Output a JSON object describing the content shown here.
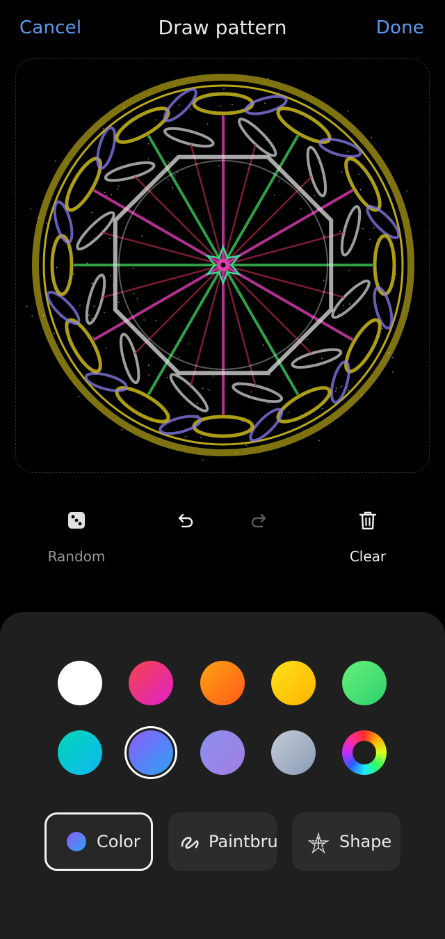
{
  "header": {
    "cancel_label": "Cancel",
    "title": "Draw pattern",
    "done_label": "Done",
    "accent_color": "#5b9cf0"
  },
  "canvas": {
    "description_icon": "kaleidoscope-pattern",
    "stroke_colors": [
      "#e6d21e",
      "#8a7cf0",
      "#e0e0e0",
      "#e03cb4",
      "#3cc85a",
      "#b02a4a"
    ]
  },
  "tools": {
    "random_label": "Random",
    "undo_icon": "undo-icon",
    "redo_icon": "redo-icon",
    "clear_label": "Clear"
  },
  "palette": {
    "selected_index": 6,
    "swatches": [
      {
        "name": "white",
        "colors": [
          "#ffffff",
          "#ffffff"
        ]
      },
      {
        "name": "pink-red",
        "colors": [
          "#f5444e",
          "#e021c8"
        ]
      },
      {
        "name": "orange",
        "colors": [
          "#ffa312",
          "#ff5a1a"
        ]
      },
      {
        "name": "yellow",
        "colors": [
          "#ffe21a",
          "#ffb300"
        ]
      },
      {
        "name": "green",
        "colors": [
          "#66f07a",
          "#2fd16e"
        ]
      },
      {
        "name": "cyan",
        "colors": [
          "#00d6b5",
          "#0fb8f0"
        ]
      },
      {
        "name": "blue-violet",
        "colors": [
          "#8c5cf7",
          "#2da2f5"
        ]
      },
      {
        "name": "lavender",
        "colors": [
          "#8b8ff0",
          "#a27fe0"
        ]
      },
      {
        "name": "grey-blue",
        "colors": [
          "#c5ccd8",
          "#8a9ab4"
        ]
      },
      {
        "name": "custom-wheel",
        "colors": [
          "#ff0000",
          "#00ff00"
        ]
      }
    ]
  },
  "modes": {
    "color_label": "Color",
    "paintbrush_label": "Paintbrush",
    "shape_label": "Shape",
    "active": "color"
  }
}
